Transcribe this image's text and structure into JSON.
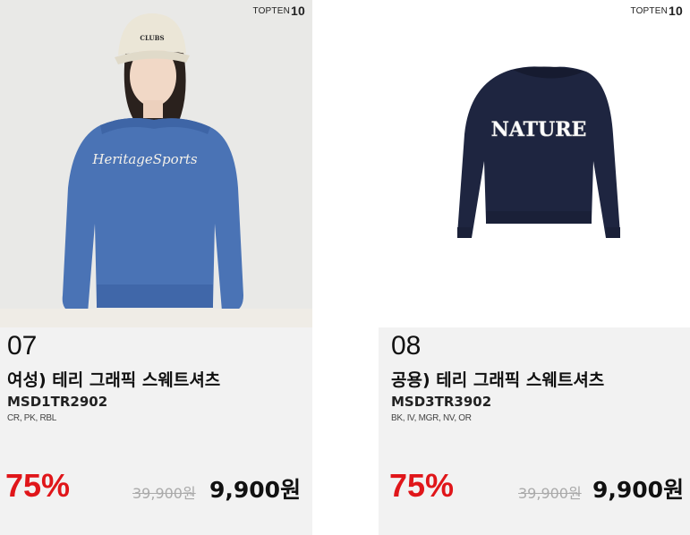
{
  "products": [
    {
      "brand_text": "TOPTEN",
      "brand_mark": "10",
      "rank": "07",
      "name": "여성) 테리 그래픽 스웨트셔츠",
      "code": "MSD1TR2902",
      "colors": "CR, PK, RBL",
      "discount": "75%",
      "original_price": "39,900원",
      "sale_price": "9,900원",
      "garment_color": "#4a73b5",
      "print_text": "HeritageSports",
      "cap_text": "CLUBS"
    },
    {
      "brand_text": "TOPTEN",
      "brand_mark": "10",
      "rank": "08",
      "name": "공용) 테리 그래픽 스웨트셔츠",
      "code": "MSD3TR3902",
      "colors": "BK, IV, MGR, NV, OR",
      "discount": "75%",
      "original_price": "39,900원",
      "sale_price": "9,900원",
      "garment_color": "#1e2540",
      "print_text": "NATURE"
    }
  ],
  "accent_color": "#e0161a"
}
